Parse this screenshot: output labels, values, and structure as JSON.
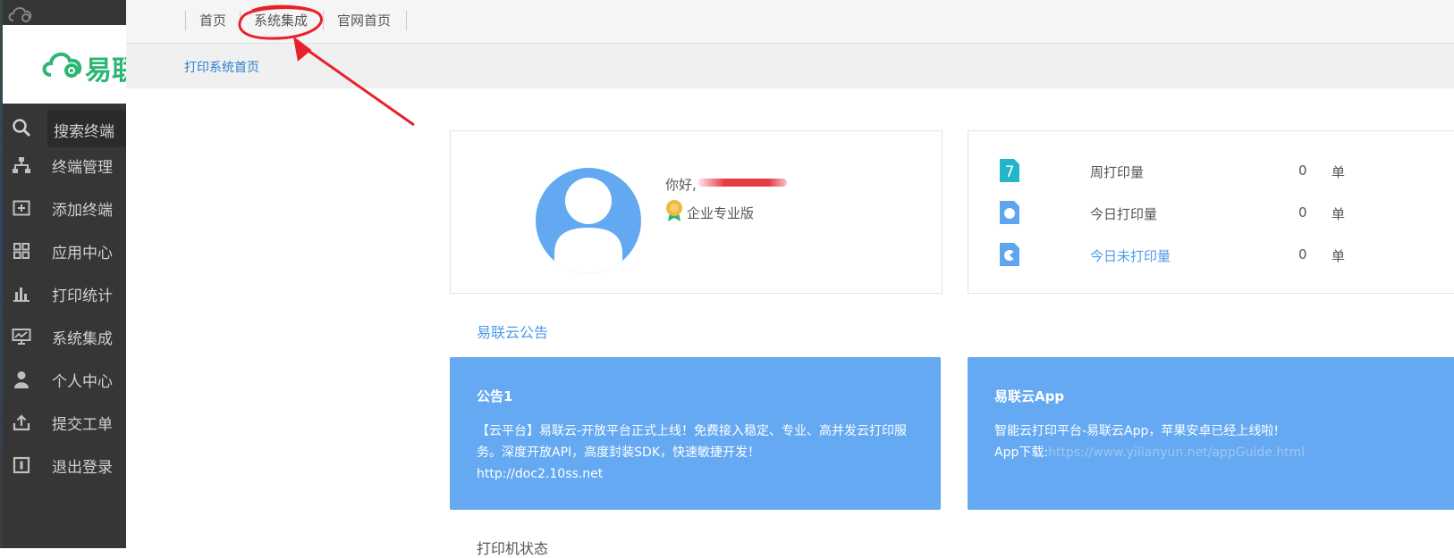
{
  "sidebar": {
    "logo_text": "易联",
    "search_label": "搜索终端",
    "items": [
      {
        "label": "终端管理",
        "icon": "sitemap-icon"
      },
      {
        "label": "添加终端",
        "icon": "add-box-icon"
      },
      {
        "label": "应用中心",
        "icon": "grid-icon"
      },
      {
        "label": "打印统计",
        "icon": "bar-chart-icon"
      },
      {
        "label": "系统集成",
        "icon": "monitor-chart-icon"
      },
      {
        "label": "个人中心",
        "icon": "user-icon"
      },
      {
        "label": "提交工单",
        "icon": "upload-icon"
      },
      {
        "label": "退出登录",
        "icon": "logout-icon"
      }
    ]
  },
  "topnav": {
    "items": [
      "首页",
      "系统集成",
      "官网首页"
    ]
  },
  "breadcrumb": "打印系统首页",
  "profile": {
    "greeting": "你好,",
    "edition": "企业专业版"
  },
  "stats": [
    {
      "icon_glyph": "7",
      "label": "周打印量",
      "value": "0",
      "unit": "单",
      "highlight": false
    },
    {
      "icon_glyph": "",
      "label": "今日打印量",
      "value": "0",
      "unit": "单",
      "highlight": false
    },
    {
      "icon_glyph": "",
      "label": "今日未打印量",
      "value": "0",
      "unit": "单",
      "highlight": true
    }
  ],
  "notice_section_title": "易联云公告",
  "notices": [
    {
      "title": "公告1",
      "body": "【云平台】易联云-开放平台正式上线！免费接入稳定、专业、高并发云打印服务。深度开放API，高度封装SDK，快速敏捷开发！",
      "body2": "http://doc2.10ss.net"
    },
    {
      "title": "易联云App",
      "body": "智能云打印平台-易联云App，苹果安卓已经上线啦!",
      "body2_label": "App下载:",
      "body2_link": "https://www.yilianyun.net/appGuide.html"
    }
  ],
  "printer_status_title": "打印机状态",
  "colors": {
    "sidebar_bg": "#363636",
    "brand_green": "#2bb673",
    "accent_blue": "#65a9f2",
    "annotation_red": "#e8202a"
  }
}
